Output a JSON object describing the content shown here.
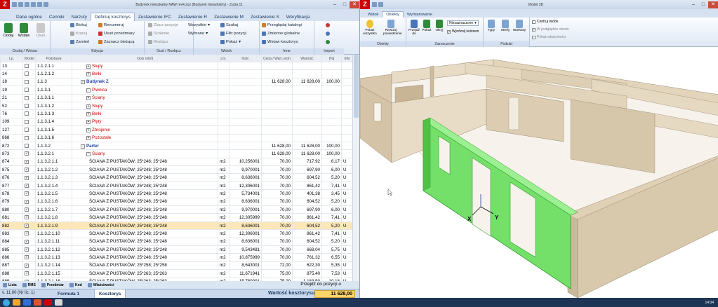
{
  "app": {
    "window_title": "Budynek mieszkalny NAW rev4.zuz (Budynek mieszkalny) - Zuzia 11",
    "logo": "Z",
    "page_size": "1",
    "accent": "#c00000",
    "highlight": "#fde7b8",
    "green_wall": "#74e06a"
  },
  "tabs": [
    "Dane ogólne",
    "Cenniki",
    "Narzuty",
    "Definiuj kosztorys",
    "Zestawienie IFC",
    "Zestawienie R",
    "Zestawienie M",
    "Zestawienie S",
    "Weryfikacja"
  ],
  "ribbon": {
    "dodaj_wstaw": {
      "caption": "Dodaj / Wstaw",
      "dodaj": "Dodaj",
      "wstaw": "Wstaw",
      "usun": "Usuń"
    },
    "edycja": {
      "caption": "Edycja",
      "blokuj": "Blokuj",
      "kopiuj": "Kopiuj",
      "zamien": "Zamień",
      "renumeruj": "Renumeruj",
      "usun_przedmiary": "Usuń przedmiary",
      "zaznacz_biezaca": "Zaznacz bieżącą"
    },
    "scal": {
      "caption": "Scal / Rozłącz",
      "zlacz": "Złącz pozycje",
      "scalenie": "Scalenie",
      "rozlacz": "Rozłącz"
    },
    "widok": {
      "caption": "Widok",
      "wszystkie": "Wszystkie",
      "wybrane": "Wybrane",
      "szukaj": "Szukaj",
      "filtr": "Filtr pozycji",
      "pokaz": "Pokaż"
    },
    "inne": {
      "caption": "Inne",
      "przegladaj": "Przeglądaj katalogi",
      "zmienne": "Zmienne globalne",
      "wstaw_kosztorys": "Wstaw kosztorys"
    },
    "import": {
      "caption": "Import"
    }
  },
  "grid": {
    "headers": [
      "Lp.",
      "Podstawa",
      "Opis robót",
      "j.m.",
      "Ilość",
      "Cena j.",
      "Wartość",
      "[%]",
      "Info"
    ],
    "header_extra": [
      "Model",
      "Cena / Wart. jedn.",
      "Wartość",
      "[%]"
    ],
    "rows": [
      {
        "lp": "13",
        "cb": "",
        "nr": "1.1.2.1.1",
        "desc": "Słupy",
        "type": "red",
        "exp": "+"
      },
      {
        "lp": "14",
        "cb": "",
        "nr": "1.1.2.1.2",
        "desc": "Belki",
        "type": "red",
        "exp": "+"
      },
      {
        "lp": "18",
        "cb": "",
        "nr": "1.1.3",
        "desc": "Budynek Z",
        "type": "blue",
        "exp": "-",
        "cena": "11 628,00",
        "wart": "11 628,00",
        "pct": "100,00"
      },
      {
        "lp": "19",
        "cb": "",
        "nr": "1.1.3.1",
        "desc": "Piwnica",
        "type": "red",
        "exp": "-"
      },
      {
        "lp": "21",
        "cb": "",
        "nr": "1.1.3.1.1",
        "desc": "Ściany",
        "type": "red",
        "exp": "+"
      },
      {
        "lp": "52",
        "cb": "",
        "nr": "1.1.3.1.2",
        "desc": "Słupy",
        "type": "red",
        "exp": "+"
      },
      {
        "lp": "76",
        "cb": "",
        "nr": "1.1.3.1.3",
        "desc": "Belki",
        "type": "red",
        "exp": "+"
      },
      {
        "lp": "109",
        "cb": "",
        "nr": "1.1.3.1.4",
        "desc": "Płyty",
        "type": "red",
        "exp": "+"
      },
      {
        "lp": "127",
        "cb": "",
        "nr": "1.1.3.1.5",
        "desc": "Zbrojenie",
        "type": "red",
        "exp": "+"
      },
      {
        "lp": "868",
        "cb": "",
        "nr": "1.1.3.1.6",
        "desc": "Pozostałe",
        "type": "red",
        "exp": "+"
      },
      {
        "lp": "872",
        "cb": "",
        "nr": "1.1.3.2",
        "desc": "Parter",
        "type": "blue",
        "exp": "-",
        "cena": "11 628,00",
        "wart": "11 628,00",
        "pct": "100,00"
      },
      {
        "lp": "873",
        "cb": "✓",
        "nr": "1.1.3.2.1",
        "desc": "Ściany",
        "type": "red",
        "exp": "-",
        "cena": "11 628,00",
        "wart": "11 628,00",
        "pct": "100,00"
      },
      {
        "lp": "874",
        "cb": "✓",
        "nr": "1.1.3.2.1.1",
        "desc": "ŚCIANA Z PUSTAKÓW; 25*248; 25*248",
        "jm": "m2",
        "il": "10,256001",
        "cena": "70,00",
        "wart": "717,92",
        "pct": "6,17",
        "info": "U"
      },
      {
        "lp": "875",
        "cb": "✓",
        "nr": "1.1.3.2.1.2",
        "desc": "ŚCIANA Z PUSTAKÓW; 25*248; 25*248",
        "jm": "m2",
        "il": "9,970001",
        "cena": "70,00",
        "wart": "697,90",
        "pct": "6,00",
        "info": "U"
      },
      {
        "lp": "876",
        "cb": "✓",
        "nr": "1.1.3.2.1.3",
        "desc": "ŚCIANA Z PUSTAKÓW; 25*248; 25*248",
        "jm": "m2",
        "il": "8,636001",
        "cena": "70,00",
        "wart": "604,52",
        "pct": "5,20",
        "info": "U"
      },
      {
        "lp": "877",
        "cb": "✓",
        "nr": "1.1.3.2.1.4",
        "desc": "ŚCIANA Z PUSTAKÓW; 25*248; 25*248",
        "jm": "m2",
        "il": "12,306001",
        "cena": "70,00",
        "wart": "861,42",
        "pct": "7,41",
        "info": "U"
      },
      {
        "lp": "878",
        "cb": "✓",
        "nr": "1.1.3.2.1.5",
        "desc": "ŚCIANA Z PUSTAKÓW; 25*248; 25*248",
        "jm": "m2",
        "il": "5,734001",
        "cena": "70,00",
        "wart": "401,38",
        "pct": "3,45",
        "info": "U"
      },
      {
        "lp": "879",
        "cb": "✓",
        "nr": "1.1.3.2.1.6",
        "desc": "ŚCIANA Z PUSTAKÓW; 25*248; 25*248",
        "jm": "m2",
        "il": "8,636001",
        "cena": "70,00",
        "wart": "604,52",
        "pct": "5,20",
        "info": "U"
      },
      {
        "lp": "880",
        "cb": "✓",
        "nr": "1.1.3.2.1.7",
        "desc": "ŚCIANA Z PUSTAKÓW; 25*248; 25*248",
        "jm": "m2",
        "il": "9,970001",
        "cena": "70,00",
        "wart": "697,90",
        "pct": "6,00",
        "info": "U"
      },
      {
        "lp": "881",
        "cb": "✓",
        "nr": "1.1.3.2.1.8",
        "desc": "ŚCIANA Z PUSTAKÓW; 25*248; 25*248",
        "jm": "m2",
        "il": "12,305999",
        "cena": "70,00",
        "wart": "861,42",
        "pct": "7,41",
        "info": "U"
      },
      {
        "lp": "882",
        "cb": "✓",
        "nr": "1.1.3.2.1.9",
        "desc": "ŚCIANA Z PUSTAKÓW; 25*248; 25*248",
        "jm": "m2",
        "il": "8,636001",
        "cena": "70,00",
        "wart": "604,52",
        "pct": "5,20",
        "info": "U",
        "sel": true
      },
      {
        "lp": "883",
        "cb": "✓",
        "nr": "1.1.3.2.1.10",
        "desc": "ŚCIANA Z PUSTAKÓW; 25*248; 25*248",
        "jm": "m2",
        "il": "12,306001",
        "cena": "70,00",
        "wart": "861,42",
        "pct": "7,41",
        "info": "U"
      },
      {
        "lp": "884",
        "cb": "✓",
        "nr": "1.1.3.2.1.11",
        "desc": "ŚCIANA Z PUSTAKÓW; 25*248; 25*248",
        "jm": "m2",
        "il": "8,636001",
        "cena": "70,00",
        "wart": "604,52",
        "pct": "5,20",
        "info": "U"
      },
      {
        "lp": "885",
        "cb": "✓",
        "nr": "1.1.3.2.1.12",
        "desc": "ŚCIANA Z PUSTAKÓW; 25*248; 25*248",
        "jm": "m2",
        "il": "9,543481",
        "cena": "70,00",
        "wart": "668,04",
        "pct": "5,75",
        "info": "U"
      },
      {
        "lp": "886",
        "cb": "✓",
        "nr": "1.1.3.2.1.13",
        "desc": "ŚCIANA Z PUSTAKÓW; 25*248; 25*248",
        "jm": "m2",
        "il": "10,875999",
        "cena": "70,00",
        "wart": "761,32",
        "pct": "6,55",
        "info": "U"
      },
      {
        "lp": "887",
        "cb": "✓",
        "nr": "1.1.3.2.1.14",
        "desc": "ŚCIANA Z PUSTAKÓW; 25*258; 25*258",
        "jm": "m2",
        "il": "8,643001",
        "cena": "72,00",
        "wart": "622,30",
        "pct": "5,35",
        "info": "U"
      },
      {
        "lp": "888",
        "cb": "✓",
        "nr": "1.1.3.2.1.15",
        "desc": "ŚCIANA Z PUSTAKÓW; 25*263; 25*263",
        "jm": "m2",
        "il": "11,671941",
        "cena": "75,00",
        "wart": "875,40",
        "pct": "7,53",
        "info": "U"
      },
      {
        "lp": "889",
        "cb": "✓",
        "nr": "1.1.3.2.1.16",
        "desc": "ŚCIANA Z PUSTAKÓW; 25*263; 25*263",
        "jm": "m2",
        "il": "15,780001",
        "cena": "75,00",
        "wart": "1 183,50",
        "pct": "10,18",
        "info": "U"
      },
      {
        "lp": "890",
        "cb": "✓",
        "nr": "1.1.3.2.1.17",
        "desc": "ŚCIANA; 20*263; 20*263",
        "jm": "",
        "il": "2,918699",
        "cena": "",
        "wart": "",
        "pct": "",
        "info": "U"
      },
      {
        "lp": "891",
        "cb": "✓",
        "nr": "1.1.3.2.1.18",
        "desc": "ŚCIANA; 20*263; 20*263",
        "jm": "",
        "il": "3,760990",
        "cena": "",
        "wart": "",
        "pct": "",
        "info": "U"
      },
      {
        "lp": "892",
        "cb": "✓",
        "nr": "1.1.3.2.1.19",
        "desc": "",
        "jm": "",
        "il": "",
        "cena": "",
        "wart": "",
        "pct": "",
        "info": ""
      }
    ]
  },
  "bottom_tabs": [
    "Lista",
    "RMS",
    "Przedmiar",
    "Kod",
    "Właściwości"
  ],
  "przejdz": "Przejdź do pozycji o",
  "status": {
    "version": "v. 11.00 (Nr lic. 1)",
    "formula_tab": "Formuła 1",
    "kosztorys_tab": "Kosztorys",
    "wartosc_label": "Wartość kosztorysu:",
    "wartosc_value": "11 628,00",
    "clock": "14:04"
  },
  "model": {
    "title": "Model 3D",
    "tabs": [
      "Widok",
      "Obiekty",
      "Wymiarowanie"
    ],
    "groups": {
      "obiekty": {
        "caption": "Obiekty",
        "pokaz_wszystko": "Pokaż wszystko",
        "rewizja": "Rewizuj powiedzenie"
      },
      "zaznaczenie": {
        "caption": "Zaznaczenie",
        "przejdz": "Przejdź do",
        "pokaz": "Pokaż",
        "ukryj": "Ukryj",
        "combo": "Niezaznaczone",
        "wyroznij": "Wyróżnij kolorem"
      },
      "podzial": {
        "caption": "Podział",
        "typy": "Typy",
        "strefy": "Strefy",
        "warstwy": "Warstwy"
      },
      "widok": {
        "centruj": "Centruj widok",
        "podglad_obr": "W podglądzie obrotu",
        "pokaz_wlasciwosci": "Pokaż właściwości"
      }
    },
    "axis_x": "X",
    "axis_y": "Y"
  }
}
